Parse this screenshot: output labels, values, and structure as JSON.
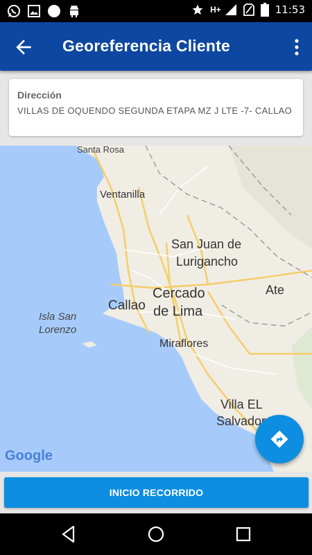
{
  "status_bar": {
    "time": "11:53",
    "network": "H+",
    "left_icons": [
      "whatsapp-icon",
      "image-icon",
      "circle-icon",
      "android-icon"
    ],
    "right_icons": [
      "star-icon",
      "signal-icon",
      "no-sim-icon",
      "battery-icon"
    ]
  },
  "app_bar": {
    "title": "Georeferencia Cliente",
    "back_icon": "arrow-back-icon",
    "menu_icon": "more-vert-icon",
    "color": "#0d47a1"
  },
  "address_card": {
    "label": "Dirección",
    "value": "VILLAS DE OQUENDO SEGUNDA ETAPA MZ J LTE -7- CALLAO"
  },
  "map": {
    "provider": "Google",
    "places": [
      "Santa Rosa",
      "Ventanilla",
      "San Juan de",
      "Lurigancho",
      "Cercado",
      "de Lima",
      "Ate",
      "Callao",
      "Isla San",
      "Lorenzo",
      "Miraflores",
      "Villa EL",
      "Salvador"
    ],
    "water_color": "#a6cbfb",
    "land_color": "#f0ede5"
  },
  "fab": {
    "icon": "directions-icon",
    "color": "#0d8ee0"
  },
  "actions": {
    "start_route": "INICIO RECORRIDO"
  },
  "nav_bar": {
    "back": "nav-back-icon",
    "home": "nav-home-icon",
    "recents": "nav-recents-icon"
  }
}
